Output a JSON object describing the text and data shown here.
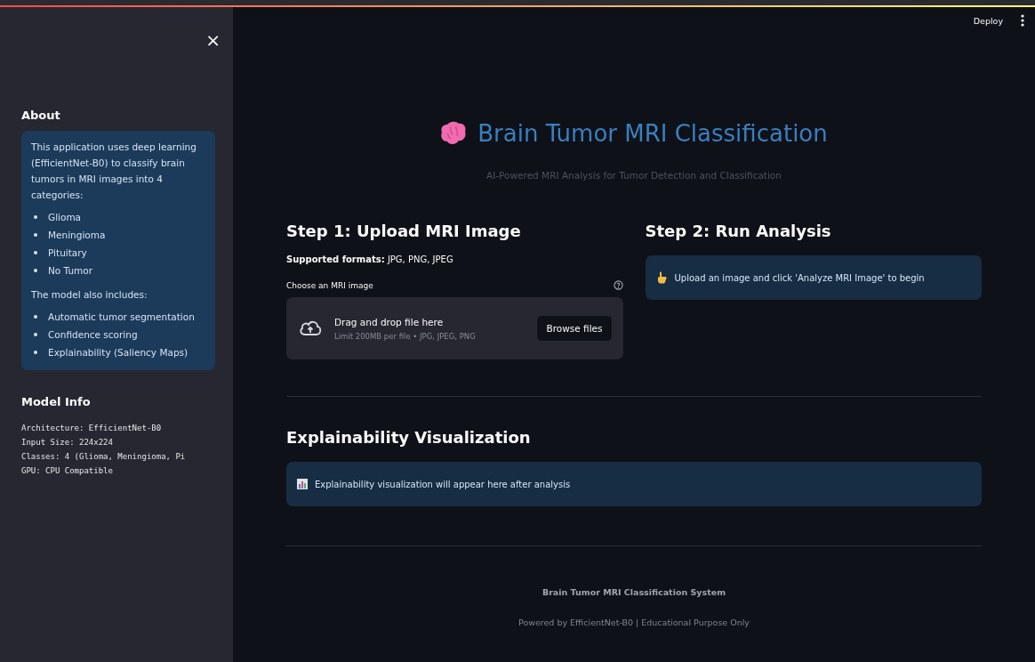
{
  "sidebar": {
    "close": "×",
    "about_title": "About",
    "about_intro": "This application uses deep learning (EfficientNet-B0) to classify brain tumors in MRI images into 4 categories:",
    "categories": [
      "Glioma",
      "Meningioma",
      "Pituitary",
      "No Tumor"
    ],
    "includes_title": "The model also includes:",
    "features": [
      "Automatic tumor segmentation",
      "Confidence scoring",
      "Explainability (Saliency Maps)"
    ],
    "model_info_title": "Model Info",
    "model_info": [
      "Architecture: EfficientNet-B0",
      "Input Size: 224x224",
      "Classes: 4 (Glioma, Meningioma, Pi",
      "GPU: CPU Compatible"
    ]
  },
  "toolbar": {
    "deploy": "Deploy"
  },
  "header": {
    "title": "Brain Tumor MRI Classification",
    "subtitle": "AI-Powered MRI Analysis for Tumor Detection and Classification"
  },
  "step1": {
    "heading": "Step 1: Upload MRI Image",
    "formats": "**Supported formats:** JPG, PNG, JPEG",
    "uploader_label": "Choose an MRI image",
    "drop_text": "Drag and drop file here",
    "limit_text": "Limit 200MB per file • JPG, JPEG, PNG",
    "browse": "Browse files"
  },
  "step2": {
    "heading": "Step 2: Run Analysis",
    "info": "Upload an image and click 'Analyze MRI Image' to begin"
  },
  "explain": {
    "heading": "Explainability Visualization",
    "info": "Explainability visualization will appear here after analysis"
  },
  "footer": {
    "title": "Brain Tumor MRI Classification System",
    "subtitle": "Powered by EfficientNet-B0 | Educational Purpose Only"
  }
}
